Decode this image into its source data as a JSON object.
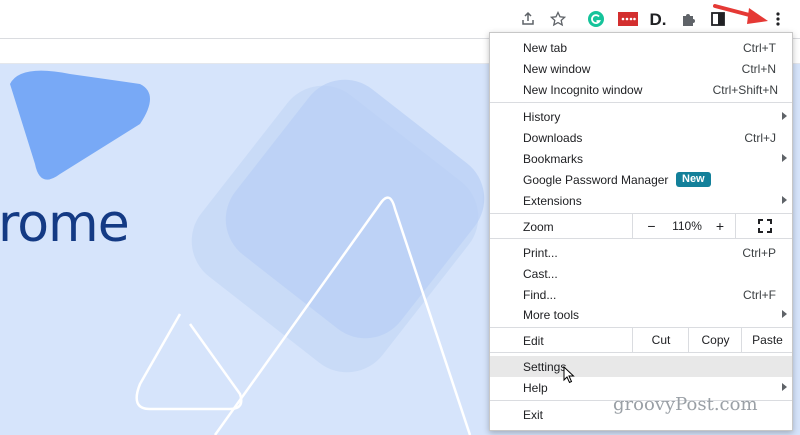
{
  "toolbar": {
    "icons": [
      "share-icon",
      "star-icon",
      "grammarly-extension-icon",
      "red-extension-icon",
      "d-extension-icon",
      "extensions-puzzle-icon",
      "sidepanel-icon",
      "kebab-menu-icon"
    ],
    "d_ext_label": "D."
  },
  "page": {
    "heading_fragment": "rome"
  },
  "menu": {
    "items": {
      "new_tab": {
        "label": "New tab",
        "shortcut": "Ctrl+T"
      },
      "new_window": {
        "label": "New window",
        "shortcut": "Ctrl+N"
      },
      "new_incognito": {
        "label": "New Incognito window",
        "shortcut": "Ctrl+Shift+N"
      },
      "history": {
        "label": "History"
      },
      "downloads": {
        "label": "Downloads",
        "shortcut": "Ctrl+J"
      },
      "bookmarks": {
        "label": "Bookmarks"
      },
      "password_manager": {
        "label": "Google Password Manager",
        "badge": "New"
      },
      "extensions": {
        "label": "Extensions"
      },
      "print": {
        "label": "Print...",
        "shortcut": "Ctrl+P"
      },
      "cast": {
        "label": "Cast..."
      },
      "find": {
        "label": "Find...",
        "shortcut": "Ctrl+F"
      },
      "more_tools": {
        "label": "More tools"
      },
      "settings": {
        "label": "Settings"
      },
      "help": {
        "label": "Help"
      },
      "exit": {
        "label": "Exit"
      }
    },
    "zoom": {
      "label": "Zoom",
      "minus": "−",
      "value": "110%",
      "plus": "+"
    },
    "edit": {
      "label": "Edit",
      "cut": "Cut",
      "copy": "Copy",
      "paste": "Paste"
    },
    "highlighted": "settings"
  },
  "watermark": "groovyPost.com",
  "colors": {
    "accent_badge": "#13809a",
    "annotation_arrow": "#e53935",
    "page_bg": "#d6e4fb"
  }
}
